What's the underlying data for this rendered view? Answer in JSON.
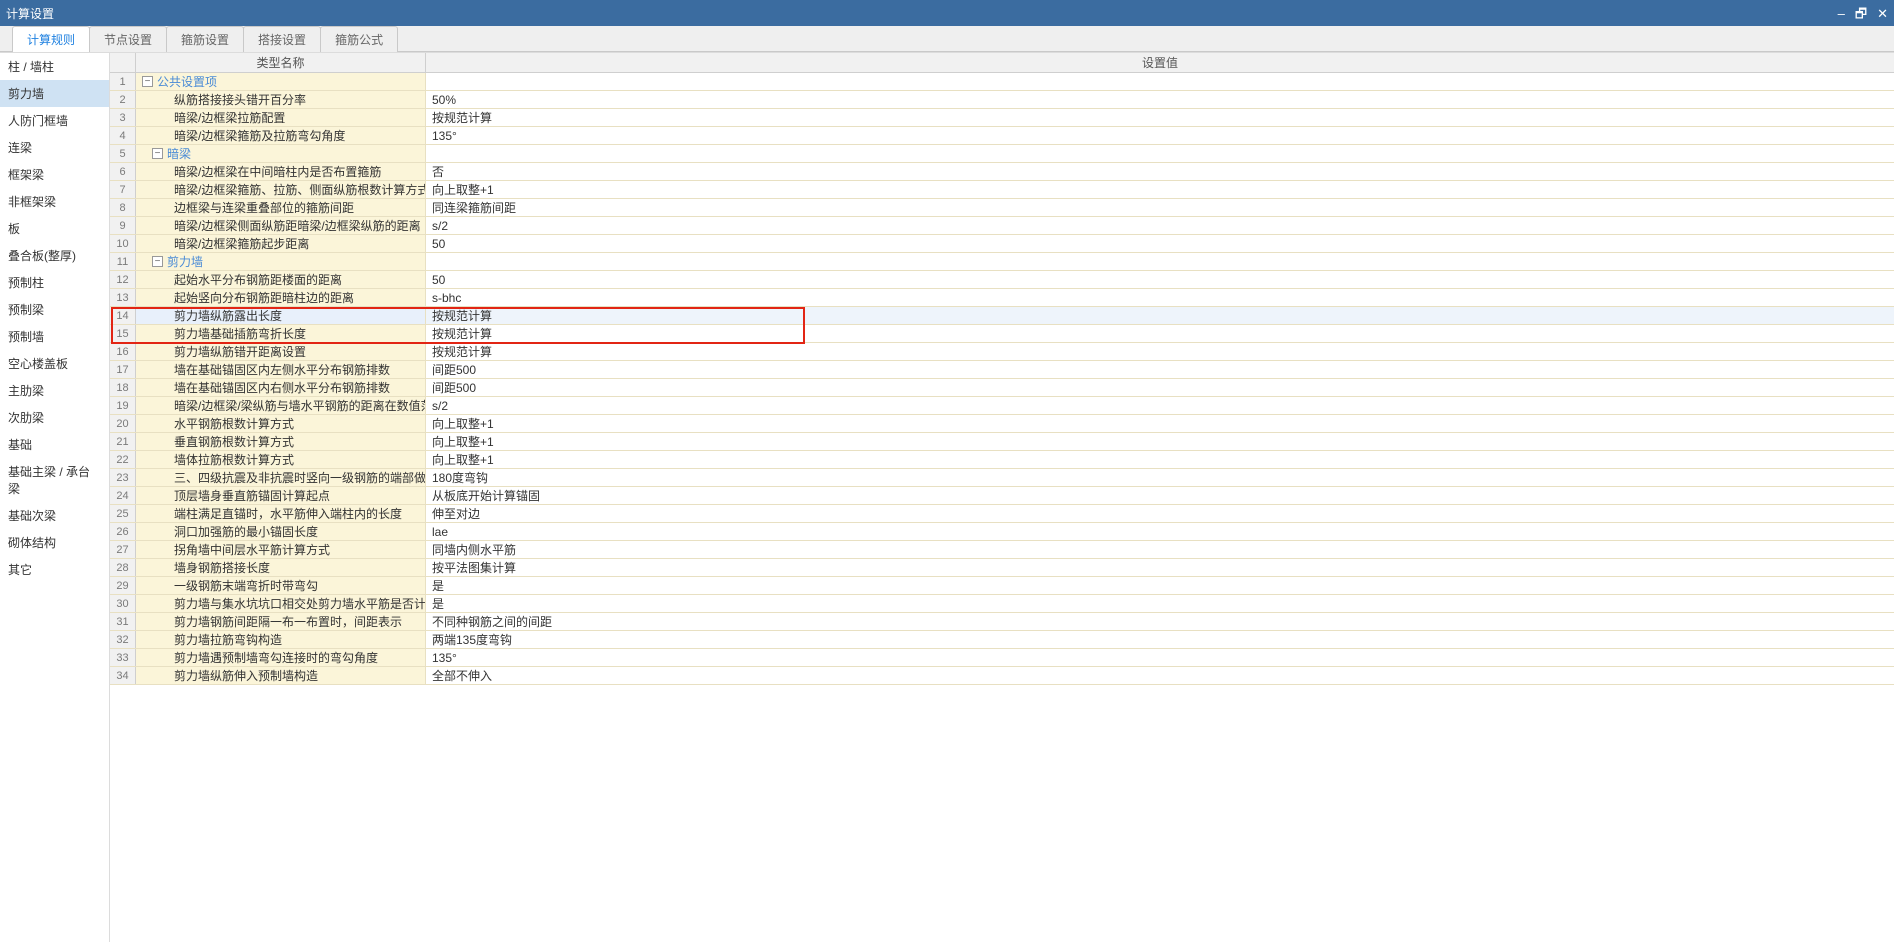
{
  "title": "计算设置",
  "tabs": [
    "计算规则",
    "节点设置",
    "箍筋设置",
    "搭接设置",
    "箍筋公式"
  ],
  "activeTab": 0,
  "sidebar": {
    "items": [
      "柱 / 墙柱",
      "剪力墙",
      "人防门框墙",
      "连梁",
      "框架梁",
      "非框架梁",
      "板",
      "叠合板(整厚)",
      "预制柱",
      "预制梁",
      "预制墙",
      "空心楼盖板",
      "主肋梁",
      "次肋梁",
      "基础",
      "基础主梁 / 承台梁",
      "基础次梁",
      "砌体结构",
      "其它"
    ],
    "activeIndex": 1
  },
  "gridHeader": {
    "name": "类型名称",
    "value": "设置值"
  },
  "rows": [
    {
      "n": 1,
      "type": "group",
      "name": "公共设置项",
      "value": ""
    },
    {
      "n": 2,
      "type": "data",
      "indent": 2,
      "name": "纵筋搭接接头错开百分率",
      "value": "50%"
    },
    {
      "n": 3,
      "type": "data",
      "indent": 2,
      "name": "暗梁/边框梁拉筋配置",
      "value": "按规范计算"
    },
    {
      "n": 4,
      "type": "data",
      "indent": 2,
      "name": "暗梁/边框梁箍筋及拉筋弯勾角度",
      "value": "135°"
    },
    {
      "n": 5,
      "type": "group",
      "indent": 1,
      "name": "暗梁",
      "value": ""
    },
    {
      "n": 6,
      "type": "data",
      "indent": 2,
      "name": "暗梁/边框梁在中间暗柱内是否布置箍筋",
      "value": "否"
    },
    {
      "n": 7,
      "type": "data",
      "indent": 2,
      "name": "暗梁/边框梁箍筋、拉筋、侧面纵筋根数计算方式",
      "value": "向上取整+1"
    },
    {
      "n": 8,
      "type": "data",
      "indent": 2,
      "name": "边框梁与连梁重叠部位的箍筋间距",
      "value": "同连梁箍筋间距"
    },
    {
      "n": 9,
      "type": "data",
      "indent": 2,
      "name": "暗梁/边框梁侧面纵筋距暗梁/边框梁纵筋的距离",
      "value": "s/2"
    },
    {
      "n": 10,
      "type": "data",
      "indent": 2,
      "name": "暗梁/边框梁箍筋起步距离",
      "value": "50"
    },
    {
      "n": 11,
      "type": "group",
      "indent": 1,
      "name": "剪力墙",
      "value": ""
    },
    {
      "n": 12,
      "type": "data",
      "indent": 2,
      "name": "起始水平分布钢筋距楼面的距离",
      "value": "50"
    },
    {
      "n": 13,
      "type": "data",
      "indent": 2,
      "name": "起始竖向分布钢筋距暗柱边的距离",
      "value": "s-bhc"
    },
    {
      "n": 14,
      "type": "data",
      "indent": 2,
      "name": "剪力墙纵筋露出长度",
      "value": "按规范计算",
      "sel": true
    },
    {
      "n": 15,
      "type": "data",
      "indent": 2,
      "name": "剪力墙基础插筋弯折长度",
      "value": "按规范计算"
    },
    {
      "n": 16,
      "type": "data",
      "indent": 2,
      "name": "剪力墙纵筋错开距离设置",
      "value": "按规范计算"
    },
    {
      "n": 17,
      "type": "data",
      "indent": 2,
      "name": "墙在基础锚固区内左侧水平分布钢筋排数",
      "value": "间距500"
    },
    {
      "n": 18,
      "type": "data",
      "indent": 2,
      "name": "墙在基础锚固区内右侧水平分布钢筋排数",
      "value": "间距500"
    },
    {
      "n": 19,
      "type": "data",
      "indent": 2,
      "name": "暗梁/边框梁/梁纵筋与墙水平钢筋的距离在数值范围内不...",
      "value": "s/2"
    },
    {
      "n": 20,
      "type": "data",
      "indent": 2,
      "name": "水平钢筋根数计算方式",
      "value": "向上取整+1"
    },
    {
      "n": 21,
      "type": "data",
      "indent": 2,
      "name": "垂直钢筋根数计算方式",
      "value": "向上取整+1"
    },
    {
      "n": 22,
      "type": "data",
      "indent": 2,
      "name": "墙体拉筋根数计算方式",
      "value": "向上取整+1"
    },
    {
      "n": 23,
      "type": "data",
      "indent": 2,
      "name": "三、四级抗震及非抗震时竖向一级钢筋的端部做法",
      "value": "180度弯钩"
    },
    {
      "n": 24,
      "type": "data",
      "indent": 2,
      "name": "顶层墙身垂直筋锚固计算起点",
      "value": "从板底开始计算锚固"
    },
    {
      "n": 25,
      "type": "data",
      "indent": 2,
      "name": "端柱满足直锚时，水平筋伸入端柱内的长度",
      "value": "伸至对边"
    },
    {
      "n": 26,
      "type": "data",
      "indent": 2,
      "name": "洞口加强筋的最小锚固长度",
      "value": "lae"
    },
    {
      "n": 27,
      "type": "data",
      "indent": 2,
      "name": "拐角墙中间层水平筋计算方式",
      "value": "同墙内侧水平筋"
    },
    {
      "n": 28,
      "type": "data",
      "indent": 2,
      "name": "墙身钢筋搭接长度",
      "value": "按平法图集计算"
    },
    {
      "n": 29,
      "type": "data",
      "indent": 2,
      "name": "一级钢筋末端弯折时带弯勾",
      "value": "是"
    },
    {
      "n": 30,
      "type": "data",
      "indent": 2,
      "name": "剪力墙与集水坑坑口相交处剪力墙水平筋是否计算",
      "value": "是"
    },
    {
      "n": 31,
      "type": "data",
      "indent": 2,
      "name": "剪力墙钢筋间距隔一布一布置时，间距表示",
      "value": "不同种钢筋之间的间距"
    },
    {
      "n": 32,
      "type": "data",
      "indent": 2,
      "name": "剪力墙拉筋弯钩构造",
      "value": "两端135度弯钩"
    },
    {
      "n": 33,
      "type": "data",
      "indent": 2,
      "name": "剪力墙遇预制墙弯勾连接时的弯勾角度",
      "value": "135°"
    },
    {
      "n": 34,
      "type": "data",
      "indent": 2,
      "name": "剪力墙纵筋伸入预制墙构造",
      "value": "全部不伸入"
    }
  ],
  "highlightTop": 234
}
